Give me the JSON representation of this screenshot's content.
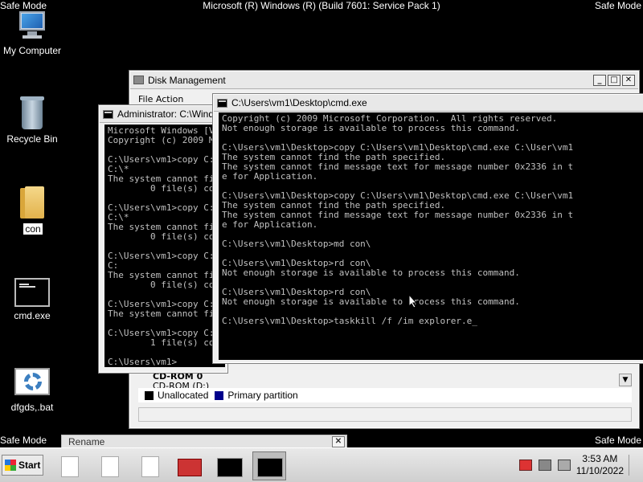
{
  "screen": {
    "banner": "Microsoft (R) Windows (R) (Build 7601: Service Pack 1)",
    "safe_mode": "Safe Mode"
  },
  "desktop_icons": [
    {
      "label": "My Computer",
      "icon": "computer-icon"
    },
    {
      "label": "Recycle Bin",
      "icon": "recycle-bin-icon"
    },
    {
      "label": "con",
      "icon": "folder-icon"
    },
    {
      "label": "cmd.exe",
      "icon": "cmd-icon"
    },
    {
      "label": "dfgds,.bat",
      "icon": "batch-file-icon"
    }
  ],
  "disk_management": {
    "title": "Disk Management",
    "menu_fragment": "File Action",
    "cdrom_label": "CD-ROM 0",
    "cdrom_sub": "CD-ROM (D:)",
    "legend": [
      {
        "label": "Unallocated",
        "color": "#000000"
      },
      {
        "label": "Primary partition",
        "color": "#00008b"
      }
    ]
  },
  "admin_cmd": {
    "title": "Administrator: C:\\Windows\\system32\\cmd.exe",
    "lines": [
      "Microsoft Windows [Version 6.1.7601]",
      "Copyright (c) 2009 Microsoft Corporation.",
      "",
      "C:\\Users\\vm1>copy C:\\Users\\vm1\\Desktop\\",
      "C:\\*",
      "The system cannot find message text",
      "        0 file(s) copied.",
      "",
      "C:\\Users\\vm1>copy C:\\Users\\vm1\\Desktop\\",
      "C:\\*",
      "The system cannot find message text",
      "        0 file(s) copied.",
      "",
      "C:\\Users\\vm1>copy C:\\Users\\vm1\\Desktop\\",
      "C:",
      "The system cannot find message text",
      "        0 file(s) copied.",
      "",
      "C:\\Users\\vm1>copy C:\\Users\\vm1\\Desktop\\",
      "The system cannot find message text",
      "",
      "C:\\Users\\vm1>copy C:\\Users\\vm1\\Desktop\\",
      "        1 file(s) copied.",
      "",
      "C:\\Users\\vm1>"
    ]
  },
  "main_cmd": {
    "title": "C:\\Users\\vm1\\Desktop\\cmd.exe",
    "lines": [
      "Copyright (c) 2009 Microsoft Corporation.  All rights reserved.",
      "Not enough storage is available to process this command.",
      "",
      "C:\\Users\\vm1\\Desktop>copy C:\\Users\\vm1\\Desktop\\cmd.exe C:\\User\\vm1",
      "The system cannot find the path specified.",
      "The system cannot find message text for message number 0x2336 in t",
      "e for Application.",
      "",
      "C:\\Users\\vm1\\Desktop>copy C:\\Users\\vm1\\Desktop\\cmd.exe C:\\User\\vm1",
      "The system cannot find the path specified.",
      "The system cannot find message text for message number 0x2336 in t",
      "e for Application.",
      "",
      "C:\\Users\\vm1\\Desktop>md con\\",
      "",
      "C:\\Users\\vm1\\Desktop>rd con\\",
      "Not enough storage is available to process this command.",
      "",
      "C:\\Users\\vm1\\Desktop>rd con\\",
      "Not enough storage is available to process this command.",
      "",
      "C:\\Users\\vm1\\Desktop>taskkill /f /im explorer.e_"
    ]
  },
  "rename_dialog": {
    "title": "Rename"
  },
  "taskbar": {
    "start_label": "Start",
    "time": "3:53 AM",
    "date": "11/10/2022"
  }
}
